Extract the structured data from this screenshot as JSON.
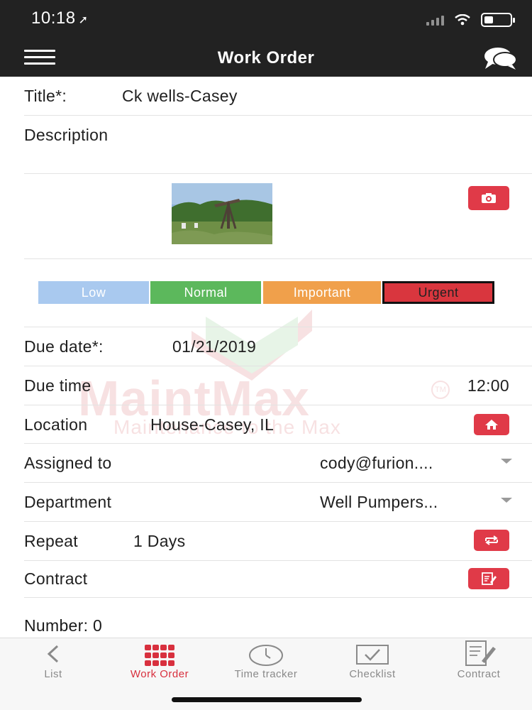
{
  "status": {
    "time": "10:18"
  },
  "header": {
    "title": "Work Order"
  },
  "form": {
    "title_label": "Title*:",
    "title_value": "Ck wells-Casey",
    "description_label": "Description",
    "priority": [
      {
        "label": "Low",
        "color": "#a9c9ef",
        "selected": false
      },
      {
        "label": "Normal",
        "color": "#5cb85c",
        "selected": false
      },
      {
        "label": "Important",
        "color": "#f0a04b",
        "selected": false
      },
      {
        "label": "Urgent",
        "color": "#d9363e",
        "selected": true
      }
    ],
    "due_date_label": "Due date*:",
    "due_date_value": "01/21/2019",
    "due_time_label": "Due time",
    "due_time_value": "12:00",
    "location_label": "Location",
    "location_value": "House-Casey, IL",
    "assigned_label": "Assigned to",
    "assigned_value": "cody@furion....",
    "department_label": "Department",
    "department_value": "Well Pumpers...",
    "repeat_label": "Repeat",
    "repeat_value": "1 Days",
    "contract_label": "Contract",
    "number_label": "Number: 0"
  },
  "watermark": {
    "brand": "MaintMax",
    "tagline": "Maintenance to the Max",
    "tm": "TM"
  },
  "tabs": [
    {
      "label": "List",
      "icon": "chevron-left-icon",
      "active": false
    },
    {
      "label": "Work Order",
      "icon": "grid-icon",
      "active": true
    },
    {
      "label": "Time tracker",
      "icon": "clock-icon",
      "active": false
    },
    {
      "label": "Checklist",
      "icon": "checklist-icon",
      "active": false
    },
    {
      "label": "Contract",
      "icon": "contract-icon",
      "active": false
    }
  ],
  "colors": {
    "accent": "#e03a48",
    "header_bg": "#222222",
    "active_tab": "#d8303e"
  }
}
